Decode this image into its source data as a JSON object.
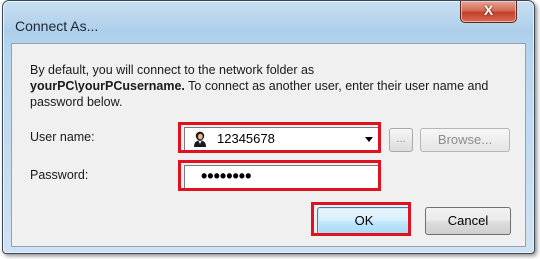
{
  "window": {
    "title": "Connect As...",
    "close_glyph": "X"
  },
  "description": {
    "line1": "By default, you will connect to the network folder as",
    "account": "yourPC\\yourPCusername.",
    "line2_rest": " To connect as another user, enter their user name and password below."
  },
  "user": {
    "label": "User name:",
    "value": "12345678",
    "icon": "user-account-icon"
  },
  "password": {
    "label": "Password:",
    "masked_value": "••••••••"
  },
  "buttons": {
    "more": "...",
    "browse": "Browse...",
    "ok": "OK",
    "cancel": "Cancel"
  },
  "colors": {
    "highlight": "#e0121f",
    "close_button": "#c4402a"
  }
}
